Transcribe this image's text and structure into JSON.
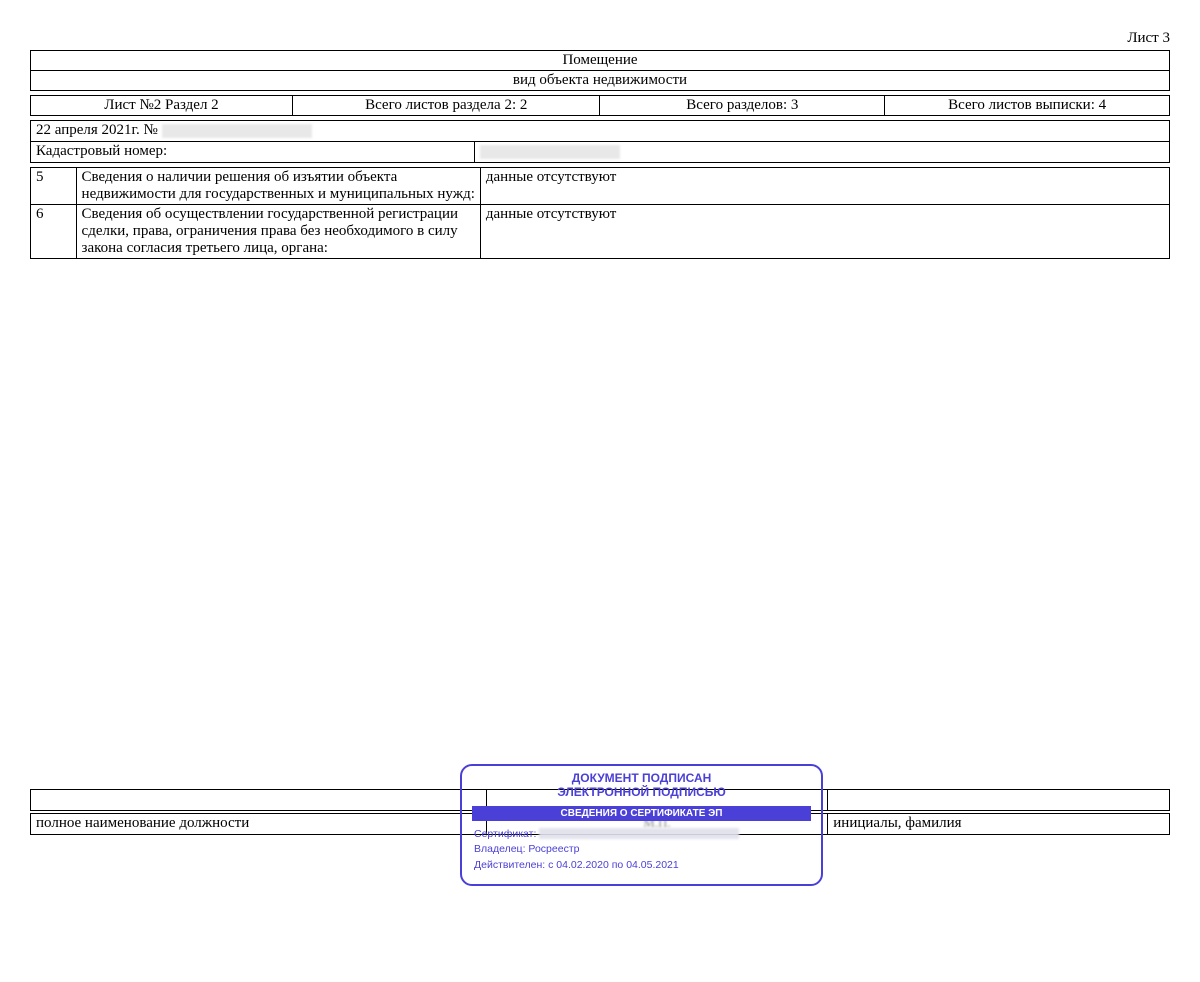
{
  "page_label": "Лист 3",
  "header": {
    "title": "Помещение",
    "subtitle": "вид объекта недвижимости"
  },
  "meta_row": {
    "c1": "Лист №2  Раздел 2",
    "c2": "Всего листов раздела 2: 2",
    "c3": "Всего разделов: 3",
    "c4": "Всего листов выписки: 4"
  },
  "number_rows": {
    "date": "22 апреля 2021г. №",
    "kadastr": "Кадастровый номер:"
  },
  "data_rows": [
    {
      "n": "5",
      "label": "Сведения о наличии решения об изъятии объекта недвижимости для государственных и муниципальных нужд:",
      "value": "данные отсутствуют"
    },
    {
      "n": "6",
      "label": "Сведения об осуществлении государственной регистрации сделки, права, ограничения права без необходимого в силу закона согласия третьего лица, органа:",
      "value": "данные отсутствуют"
    }
  ],
  "footer": {
    "position_label": "полное наименование должности",
    "initials_label": "инициалы, фамилия",
    "mp": "М.П."
  },
  "stamp": {
    "line1": "ДОКУМЕНТ ПОДПИСАН",
    "line2": "ЭЛЕКТРОННОЙ ПОДПИСЬЮ",
    "bar": "СВЕДЕНИЯ О СЕРТИФИКАТЕ ЭП",
    "cert_label": "Сертификат:",
    "owner_label": "Владелец:",
    "owner_value": "Росреестр",
    "valid_label": "Действителен:",
    "valid_value": "с 04.02.2020 по 04.05.2021"
  }
}
